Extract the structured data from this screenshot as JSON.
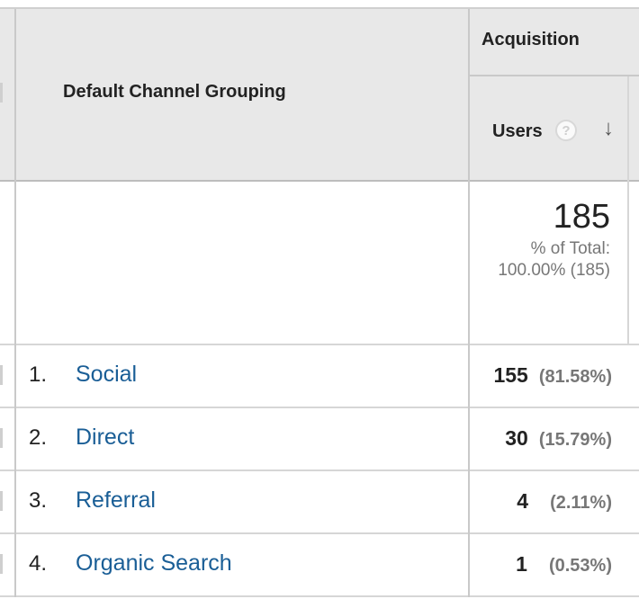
{
  "header": {
    "group_label": "Acquisition",
    "dimension_label": "Default Channel Grouping",
    "metric_label": "Users",
    "help_glyph": "?",
    "sort_icon": "arrow-down-icon"
  },
  "totals": {
    "value": "185",
    "pct_line1": "% of Total:",
    "pct_line2": "100.00% (185)"
  },
  "rows": [
    {
      "index": "1.",
      "channel": "Social",
      "users": "155",
      "pct": "(81.58%)"
    },
    {
      "index": "2.",
      "channel": "Direct",
      "users": "30",
      "pct": "(15.79%)"
    },
    {
      "index": "3.",
      "channel": "Referral",
      "users": "4",
      "pct": "(2.11%)"
    },
    {
      "index": "4.",
      "channel": "Organic Search",
      "users": "1",
      "pct": "(0.53%)"
    }
  ],
  "colors": {
    "link": "#1a5e96",
    "header_bg": "#e8e8e8",
    "muted_text": "#777777"
  }
}
